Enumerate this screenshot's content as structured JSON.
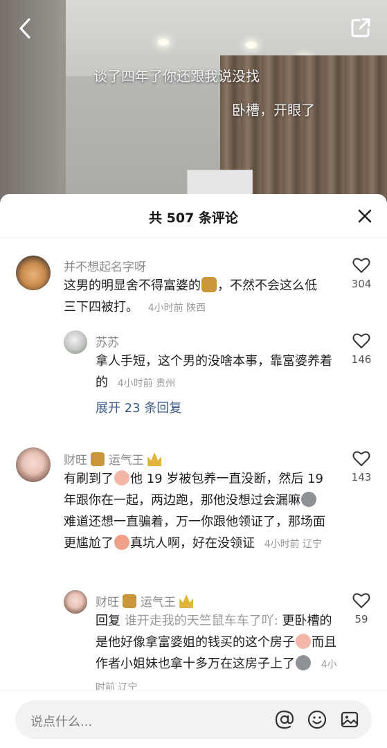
{
  "video": {
    "caption_1": "谈了四年了你还跟我说没找",
    "caption_2": "卧槽，开眼了"
  },
  "panel": {
    "title": "共 507 条评论"
  },
  "comments": [
    {
      "username": "并不想起名字呀",
      "text_1": "这男的明显舍不得富婆的",
      "text_2": "，不然不会这么低三下四被打。",
      "meta": "4小时前 陕西",
      "likes": "304"
    },
    {
      "username": "苏苏",
      "text": "拿人手短，这个男的没啥本事，靠富婆养着的",
      "meta": "4小时前 贵州",
      "likes": "146",
      "expand": "展开 23 条回复"
    },
    {
      "username_1": "财旺",
      "username_2": "运气王",
      "text_1": "有刷到了",
      "text_2": "他 19 岁被包养一直没断，然后 19 年跟你在一起，两边跑，那他没想过会漏嘛",
      "text_3": "难道还想一直骗着，万一你跟他领证了，那场面更尴尬了",
      "text_4": "真坑人啊，好在没领证",
      "meta": "4小时前 辽宁",
      "likes": "143"
    },
    {
      "username_1": "财旺",
      "username_2": "运气王",
      "reply_prefix": "回复",
      "reply_target": "谁开走我的天竺鼠车车了吖:",
      "text_1": " 更卧槽的是他好像拿富婆姐的钱买的这个房子",
      "text_2": "而且作者小姐妹也拿十多万在这房子上了",
      "meta": "4小时前 辽宁",
      "likes": "59"
    }
  ],
  "input": {
    "placeholder": "说点什么..."
  },
  "colors": {
    "link": "#3a5a88",
    "muted": "#8a8a8a"
  }
}
